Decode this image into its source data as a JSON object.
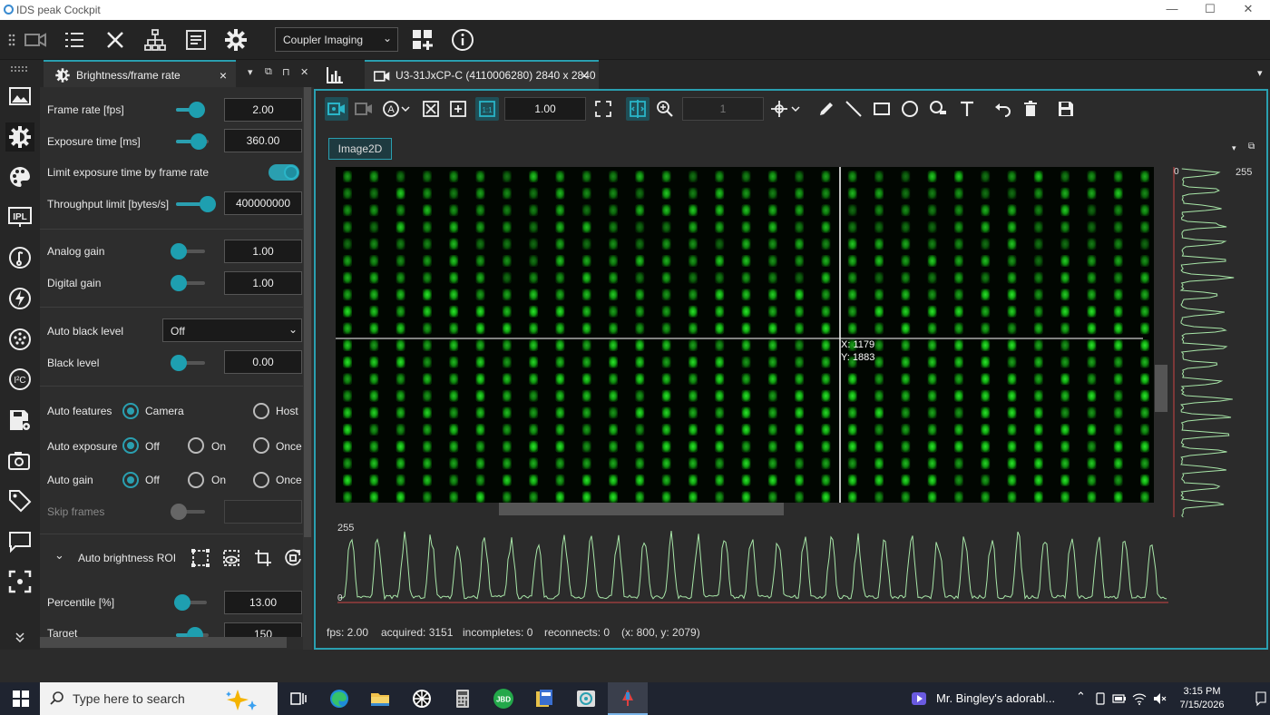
{
  "app": {
    "title": "IDS peak Cockpit",
    "window_controls": [
      "—",
      "☐",
      "✕"
    ]
  },
  "toolbar": {
    "profile_select": "Coupler Imaging"
  },
  "panel": {
    "tab_title": "Brightness/frame rate",
    "tab_close": "×",
    "tab_controls": [
      "▾",
      "⧉",
      "⊓",
      "✕"
    ],
    "frame_rate": {
      "label": "Frame rate [fps]",
      "value": "2.00",
      "level": 0.6
    },
    "exposure_time": {
      "label": "Exposure time [ms]",
      "value": "360.00",
      "level": 0.65
    },
    "limit_exposure": {
      "label": "Limit exposure time by frame rate",
      "enabled": true
    },
    "throughput_limit": {
      "label": "Throughput limit [bytes/s]",
      "value": "400000000",
      "level": 0.9
    },
    "analog_gain": {
      "label": "Analog gain",
      "value": "1.00",
      "level": 0.0
    },
    "digital_gain": {
      "label": "Digital gain",
      "value": "1.00",
      "level": 0.0
    },
    "auto_black_level": {
      "label": "Auto black level",
      "value": "Off"
    },
    "black_level": {
      "label": "Black level",
      "value": "0.00",
      "level": 0.0
    },
    "auto_features": {
      "label": "Auto features",
      "options": [
        "Camera",
        "Host"
      ],
      "selected": "Camera"
    },
    "auto_exposure": {
      "label": "Auto exposure",
      "options": [
        "Off",
        "On",
        "Once"
      ],
      "selected": "Off"
    },
    "auto_gain": {
      "label": "Auto gain",
      "options": [
        "Off",
        "On",
        "Once"
      ],
      "selected": "Off"
    },
    "skip_frames": {
      "label": "Skip frames",
      "value": "",
      "level": 0.0
    },
    "roi_section": {
      "label": "Auto brightness ROI",
      "chevron": "⌄"
    },
    "percentile": {
      "label": "Percentile [%]",
      "value": "13.00",
      "level": 0.15
    },
    "target": {
      "label": "Target",
      "value": "150",
      "level": 0.45
    }
  },
  "viewer": {
    "tab_title": "U3-31JxCP-C (4110006280) 2840 x 2840",
    "tab_close": "×",
    "zoom_value": "1.00",
    "frame_index": "1",
    "image_tab": "Image2D",
    "cursor": {
      "x_label": "X: 1179",
      "y_label": "Y: 1883"
    },
    "right_projection": {
      "min": "0",
      "max": "255"
    },
    "bottom_projection": {
      "min": "0",
      "max": "255"
    }
  },
  "status": {
    "fps": "fps: 2.00",
    "acquired": "acquired: 3151",
    "incompletes": "incompletes: 0",
    "reconnects": "reconnects: 0",
    "position": "(x: 800, y: 2079)"
  },
  "taskbar": {
    "search_placeholder": "Type here to search",
    "notification": "Mr. Bingley's adorabl...",
    "time": "3:15 PM",
    "date": "7/15/2026",
    "jb_label": "JBD"
  },
  "colors": {
    "accent": "#2a9fb0",
    "background": "#2b2b2b",
    "plot_line": "#a8e6a8",
    "plot_axis": "#cc4444"
  }
}
